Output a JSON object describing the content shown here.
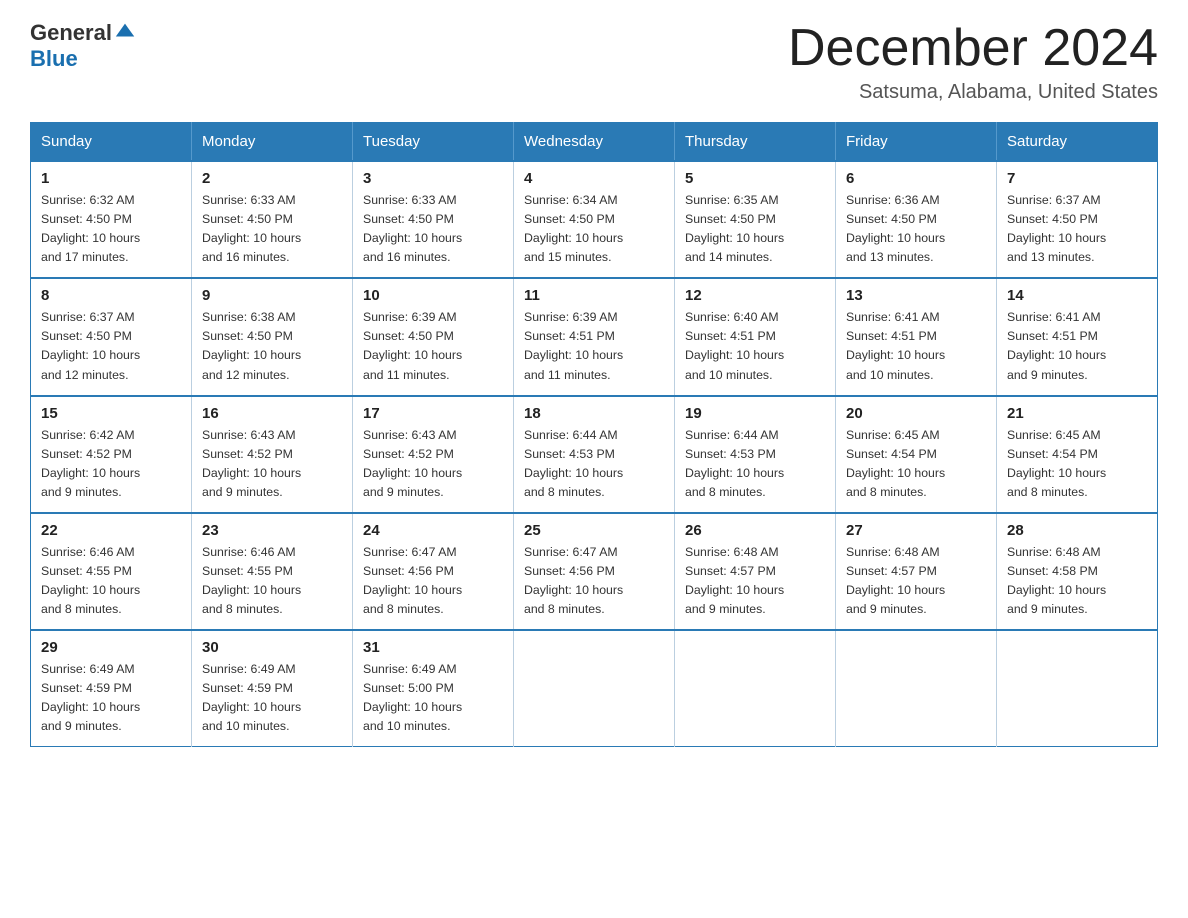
{
  "header": {
    "logo_general": "General",
    "logo_blue": "Blue",
    "month_title": "December 2024",
    "subtitle": "Satsuma, Alabama, United States"
  },
  "days_of_week": [
    "Sunday",
    "Monday",
    "Tuesday",
    "Wednesday",
    "Thursday",
    "Friday",
    "Saturday"
  ],
  "weeks": [
    [
      {
        "day": "1",
        "sunrise": "6:32 AM",
        "sunset": "4:50 PM",
        "daylight": "10 hours and 17 minutes."
      },
      {
        "day": "2",
        "sunrise": "6:33 AM",
        "sunset": "4:50 PM",
        "daylight": "10 hours and 16 minutes."
      },
      {
        "day": "3",
        "sunrise": "6:33 AM",
        "sunset": "4:50 PM",
        "daylight": "10 hours and 16 minutes."
      },
      {
        "day": "4",
        "sunrise": "6:34 AM",
        "sunset": "4:50 PM",
        "daylight": "10 hours and 15 minutes."
      },
      {
        "day": "5",
        "sunrise": "6:35 AM",
        "sunset": "4:50 PM",
        "daylight": "10 hours and 14 minutes."
      },
      {
        "day": "6",
        "sunrise": "6:36 AM",
        "sunset": "4:50 PM",
        "daylight": "10 hours and 13 minutes."
      },
      {
        "day": "7",
        "sunrise": "6:37 AM",
        "sunset": "4:50 PM",
        "daylight": "10 hours and 13 minutes."
      }
    ],
    [
      {
        "day": "8",
        "sunrise": "6:37 AM",
        "sunset": "4:50 PM",
        "daylight": "10 hours and 12 minutes."
      },
      {
        "day": "9",
        "sunrise": "6:38 AM",
        "sunset": "4:50 PM",
        "daylight": "10 hours and 12 minutes."
      },
      {
        "day": "10",
        "sunrise": "6:39 AM",
        "sunset": "4:50 PM",
        "daylight": "10 hours and 11 minutes."
      },
      {
        "day": "11",
        "sunrise": "6:39 AM",
        "sunset": "4:51 PM",
        "daylight": "10 hours and 11 minutes."
      },
      {
        "day": "12",
        "sunrise": "6:40 AM",
        "sunset": "4:51 PM",
        "daylight": "10 hours and 10 minutes."
      },
      {
        "day": "13",
        "sunrise": "6:41 AM",
        "sunset": "4:51 PM",
        "daylight": "10 hours and 10 minutes."
      },
      {
        "day": "14",
        "sunrise": "6:41 AM",
        "sunset": "4:51 PM",
        "daylight": "10 hours and 9 minutes."
      }
    ],
    [
      {
        "day": "15",
        "sunrise": "6:42 AM",
        "sunset": "4:52 PM",
        "daylight": "10 hours and 9 minutes."
      },
      {
        "day": "16",
        "sunrise": "6:43 AM",
        "sunset": "4:52 PM",
        "daylight": "10 hours and 9 minutes."
      },
      {
        "day": "17",
        "sunrise": "6:43 AM",
        "sunset": "4:52 PM",
        "daylight": "10 hours and 9 minutes."
      },
      {
        "day": "18",
        "sunrise": "6:44 AM",
        "sunset": "4:53 PM",
        "daylight": "10 hours and 8 minutes."
      },
      {
        "day": "19",
        "sunrise": "6:44 AM",
        "sunset": "4:53 PM",
        "daylight": "10 hours and 8 minutes."
      },
      {
        "day": "20",
        "sunrise": "6:45 AM",
        "sunset": "4:54 PM",
        "daylight": "10 hours and 8 minutes."
      },
      {
        "day": "21",
        "sunrise": "6:45 AM",
        "sunset": "4:54 PM",
        "daylight": "10 hours and 8 minutes."
      }
    ],
    [
      {
        "day": "22",
        "sunrise": "6:46 AM",
        "sunset": "4:55 PM",
        "daylight": "10 hours and 8 minutes."
      },
      {
        "day": "23",
        "sunrise": "6:46 AM",
        "sunset": "4:55 PM",
        "daylight": "10 hours and 8 minutes."
      },
      {
        "day": "24",
        "sunrise": "6:47 AM",
        "sunset": "4:56 PM",
        "daylight": "10 hours and 8 minutes."
      },
      {
        "day": "25",
        "sunrise": "6:47 AM",
        "sunset": "4:56 PM",
        "daylight": "10 hours and 8 minutes."
      },
      {
        "day": "26",
        "sunrise": "6:48 AM",
        "sunset": "4:57 PM",
        "daylight": "10 hours and 9 minutes."
      },
      {
        "day": "27",
        "sunrise": "6:48 AM",
        "sunset": "4:57 PM",
        "daylight": "10 hours and 9 minutes."
      },
      {
        "day": "28",
        "sunrise": "6:48 AM",
        "sunset": "4:58 PM",
        "daylight": "10 hours and 9 minutes."
      }
    ],
    [
      {
        "day": "29",
        "sunrise": "6:49 AM",
        "sunset": "4:59 PM",
        "daylight": "10 hours and 9 minutes."
      },
      {
        "day": "30",
        "sunrise": "6:49 AM",
        "sunset": "4:59 PM",
        "daylight": "10 hours and 10 minutes."
      },
      {
        "day": "31",
        "sunrise": "6:49 AM",
        "sunset": "5:00 PM",
        "daylight": "10 hours and 10 minutes."
      },
      null,
      null,
      null,
      null
    ]
  ],
  "labels": {
    "sunrise_prefix": "Sunrise: ",
    "sunset_prefix": "Sunset: ",
    "daylight_prefix": "Daylight: "
  }
}
